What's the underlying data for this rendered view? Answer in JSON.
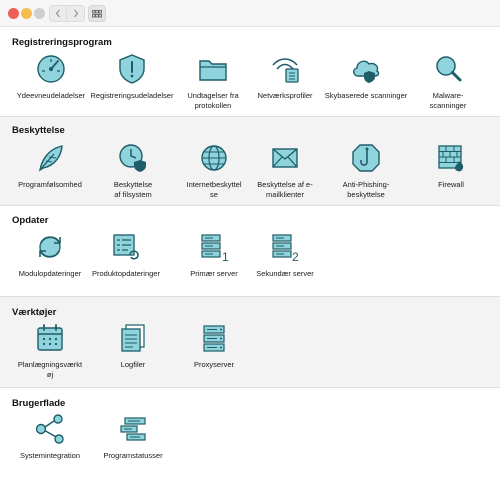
{
  "theme": {
    "icon_stroke": "#1e5d69",
    "icon_fill": "#8fd3dc",
    "section_shade": "#f3f3f3"
  },
  "toolbar": {
    "back_icon": "chevron-left-icon",
    "forward_icon": "chevron-right-icon",
    "grid_icon": "grid-view-icon"
  },
  "sections": [
    {
      "title": "Registreringsprogram",
      "items": [
        {
          "label": "Ydeevneudeladelser",
          "icon": "speedometer-icon"
        },
        {
          "label": "Registreringsudeladelser",
          "icon": "warning-shield-icon"
        },
        {
          "label": "Undtagelser fra\nprotokollen",
          "icon": "folder-icon"
        },
        {
          "label": "Netværksprofiler",
          "icon": "wifi-network-icon"
        },
        {
          "label": "Skybaserede scanninger",
          "icon": "cloud-shield-icon"
        },
        {
          "label": "Malware-\nscanninger",
          "icon": "magnifier-icon"
        }
      ]
    },
    {
      "title": "Beskyttelse",
      "items": [
        {
          "label": "Programfølsomhed",
          "icon": "feather-icon"
        },
        {
          "label": "Beskyttelse\naf filsystem",
          "icon": "clock-shield-icon"
        },
        {
          "label": "Internetbeskyttel\nse",
          "icon": "globe-icon"
        },
        {
          "label": "Beskyttelse af e-\nmailklienter",
          "icon": "envelope-icon"
        },
        {
          "label": "Anti-Phishing-\nbeskyttelse",
          "icon": "hook-shield-icon"
        },
        {
          "label": "Firewall",
          "icon": "firewall-icon"
        }
      ]
    },
    {
      "title": "Opdater",
      "items": [
        {
          "label": "Modulopdateringer",
          "icon": "refresh-icon"
        },
        {
          "label": "Produktopdateringer",
          "icon": "list-refresh-icon"
        },
        {
          "label": "Primær server",
          "icon": "server-one-icon"
        },
        {
          "label": "Sekundær server",
          "icon": "server-two-icon"
        }
      ]
    },
    {
      "title": "Værktøjer",
      "items": [
        {
          "label": "Planlægningsværkt\nøj",
          "icon": "calendar-icon"
        },
        {
          "label": "Logfiler",
          "icon": "log-files-icon"
        },
        {
          "label": "Proxyserver",
          "icon": "proxy-server-icon"
        }
      ]
    },
    {
      "title": "Brugerflade",
      "items": [
        {
          "label": "Systemintegration",
          "icon": "share-nodes-icon"
        },
        {
          "label": "Programstatusser",
          "icon": "status-bars-icon"
        }
      ]
    }
  ]
}
